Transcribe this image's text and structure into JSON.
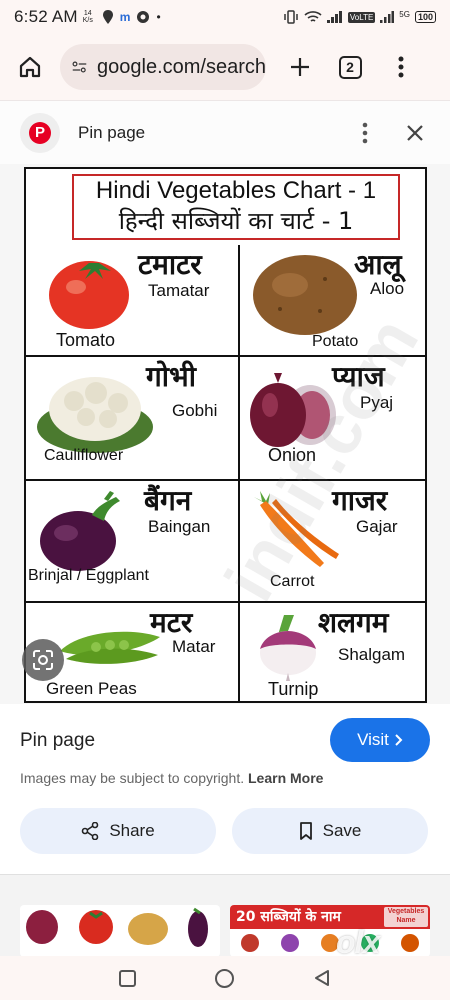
{
  "status_bar": {
    "time": "6:52 AM",
    "kbs": "14 K/s",
    "volte": "VoLTE",
    "network": "5G",
    "battery": "100"
  },
  "toolbar": {
    "url": "google.com/search",
    "tab_count": "2"
  },
  "pin_header": {
    "title": "Pin page"
  },
  "chart": {
    "title_en": "Hindi Vegetables Chart - 1",
    "title_hi": "हिन्दी सब्जियों का चार्ट - 1",
    "watermark": "indif.com",
    "items": [
      {
        "hindi": "टमाटर",
        "translit": "Tamatar",
        "english": "Tomato"
      },
      {
        "hindi": "आलू",
        "translit": "Aloo",
        "english": "Potato"
      },
      {
        "hindi": "गोभी",
        "translit": "Gobhi",
        "english": "Cauliflower"
      },
      {
        "hindi": "प्याज",
        "translit": "Pyaj",
        "english": "Onion"
      },
      {
        "hindi": "बैंगन",
        "translit": "Baingan",
        "english": "Brinjal / Eggplant"
      },
      {
        "hindi": "गाजर",
        "translit": "Gajar",
        "english": "Carrot"
      },
      {
        "hindi": "मटर",
        "translit": "Matar",
        "english": "Green Peas"
      },
      {
        "hindi": "शलगम",
        "translit": "Shalgam",
        "english": "Turnip"
      }
    ]
  },
  "details": {
    "title": "Pin page",
    "visit_label": "Visit",
    "copyright": "Images may be subject to copyright.",
    "learn_more": "Learn More",
    "share_label": "Share",
    "save_label": "Save"
  },
  "related": {
    "banner_text": "20 सब्जियों के नाम",
    "tag_text": "Vegetables Name",
    "olx_text": "olx"
  },
  "colors": {
    "accent": "#1a73e8",
    "pinterest": "#e60023",
    "title_border": "#c62828"
  }
}
